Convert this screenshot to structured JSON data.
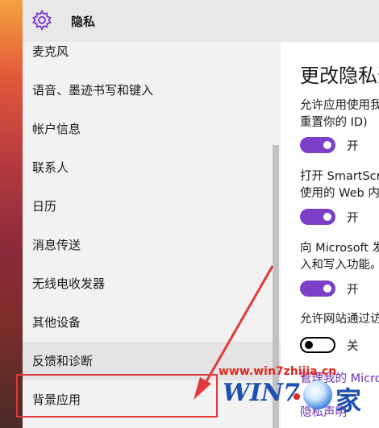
{
  "window": {
    "title": "隐私",
    "icon": "gear-icon"
  },
  "sidebar": {
    "items": [
      {
        "label": "麦克风"
      },
      {
        "label": "语音、墨迹书写和键入"
      },
      {
        "label": "帐户信息"
      },
      {
        "label": "联系人"
      },
      {
        "label": "日历"
      },
      {
        "label": "消息传送"
      },
      {
        "label": "无线电收发器"
      },
      {
        "label": "其他设备"
      },
      {
        "label": "反馈和诊断"
      },
      {
        "label": "背景应用"
      }
    ]
  },
  "content": {
    "heading": "更改隐私选",
    "settings": [
      {
        "lines": [
          "允许应用使用我",
          "重置你的 ID)"
        ],
        "state": "on",
        "state_label": "开"
      },
      {
        "lines": [
          "打开 SmartScr",
          "使用的 Web 内"
        ],
        "state": "on",
        "state_label": "开"
      },
      {
        "lines": [
          "向 Microsoft 发",
          "入和写入功能。"
        ],
        "state": "on",
        "state_label": "开"
      },
      {
        "lines": [
          "允许网站通过访"
        ],
        "state": "off",
        "state_label": "关"
      }
    ],
    "privacy_link": "管理我的 Micro",
    "privacy_statement": "隐私声明"
  },
  "colors": {
    "accent": "#7b3fc8",
    "highlight_box": "#e23a3a",
    "link": "#6b2fb5"
  },
  "watermark": {
    "url": "www.win7zhijia.cn",
    "logo_text": "WIN7",
    "logo_suffix": "家"
  }
}
